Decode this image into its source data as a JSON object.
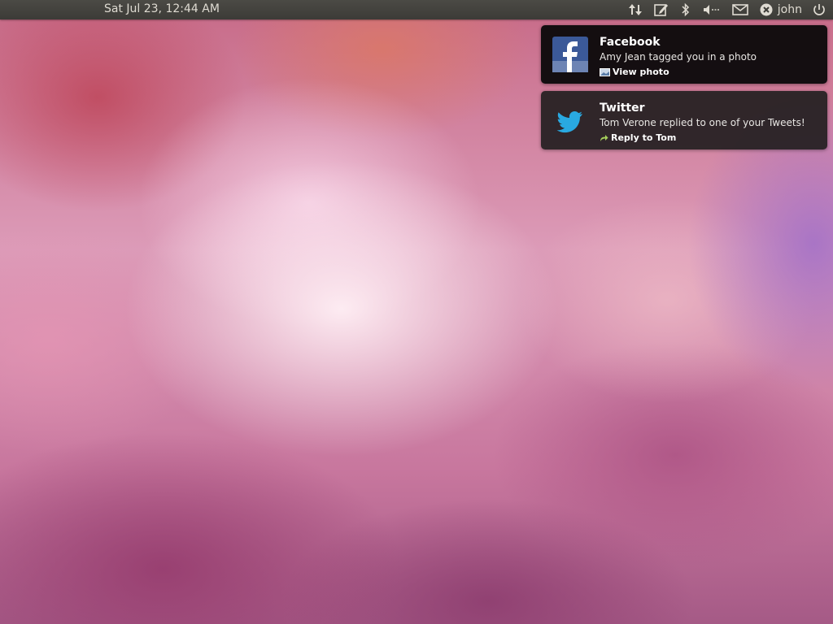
{
  "panel": {
    "clock": "Sat Jul 23, 12:44 AM",
    "indicators": [
      {
        "icon": "network-arrows-icon"
      },
      {
        "icon": "notes-pad-icon"
      },
      {
        "icon": "bluetooth-icon"
      },
      {
        "icon": "volume-icon"
      },
      {
        "icon": "mail-envelope-icon"
      },
      {
        "icon": "user-status-icon"
      },
      {
        "icon": "power-icon"
      }
    ],
    "user_name": "john"
  },
  "notifications": [
    {
      "app": "Facebook",
      "icon": "facebook-icon",
      "message": "Amy Jean tagged you in a photo",
      "action_label": "View photo",
      "action_icon": "photo-icon",
      "accent_color": "#3b5998"
    },
    {
      "app": "Twitter",
      "icon": "twitter-bird-icon",
      "message": "Tom Verone replied to one of your Tweets!",
      "action_label": "Reply to Tom",
      "action_icon": "reply-arrow-icon",
      "accent_color": "#29a9e1"
    }
  ],
  "colors": {
    "panel_background": "#3c3b37",
    "panel_text": "#dfdbd2",
    "bubble_background": "#1a181a",
    "reply_arrow": "#a6d05c"
  }
}
